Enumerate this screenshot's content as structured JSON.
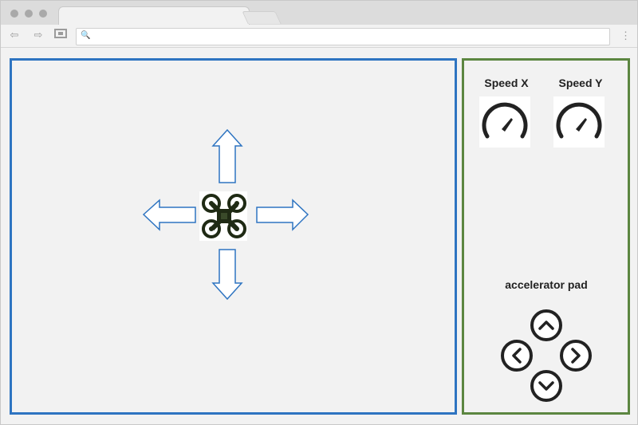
{
  "browser": {
    "address_bar": {
      "value": "",
      "placeholder": ""
    }
  },
  "colors": {
    "canvas_border": "#2e74c1",
    "control_border": "#5c8641",
    "arrow_outline": "#2e74c1",
    "icon_dark": "#222222"
  },
  "canvas": {
    "drone_icon": "drone-icon",
    "direction_arrows": [
      "up",
      "down",
      "left",
      "right"
    ]
  },
  "controls": {
    "speed_x": {
      "label": "Speed X",
      "icon": "speedometer-icon"
    },
    "speed_y": {
      "label": "Speed Y",
      "icon": "speedometer-icon"
    },
    "accelerator_pad": {
      "label": "accelerator pad",
      "buttons": [
        "up",
        "left",
        "right",
        "down"
      ]
    }
  }
}
